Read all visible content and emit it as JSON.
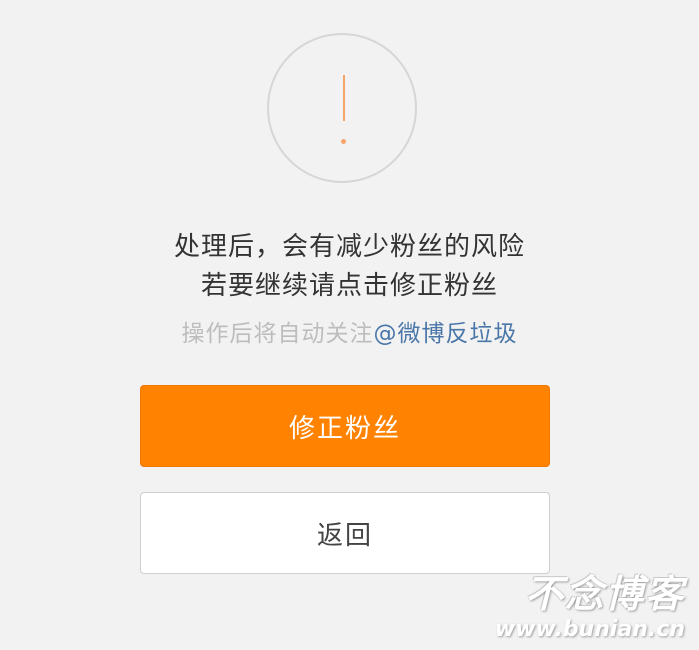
{
  "dialog": {
    "icon": "exclamation-icon",
    "warning_line1": "处理后，会有减少粉丝的风险",
    "warning_line2": "若要继续请点击修正粉丝",
    "note_prefix": "操作后将自动关注",
    "note_link": "@微博反垃圾",
    "primary_button": "修正粉丝",
    "secondary_button": "返回"
  },
  "watermark": {
    "title": "不念博客",
    "url": "www.bunian.cn"
  },
  "colors": {
    "accent": "#ff8200",
    "link": "#4a76a8",
    "icon": "#f6a46a",
    "background": "#f2f2f2"
  }
}
